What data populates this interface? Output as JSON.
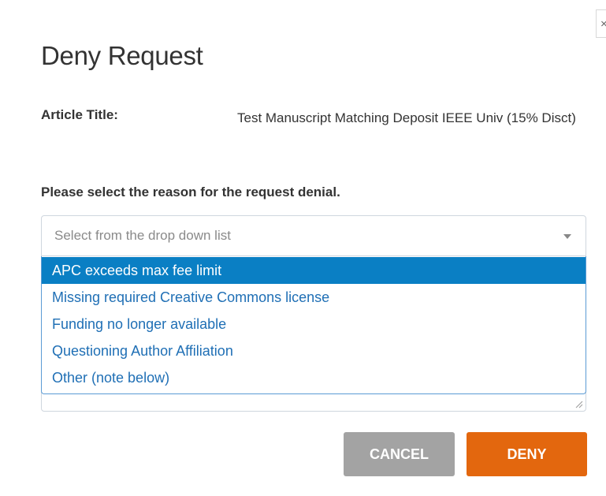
{
  "modal": {
    "title": "Deny Request",
    "close_label": "×",
    "article": {
      "label": "Article Title:",
      "value": "Test Manuscript Matching Deposit IEEE Univ (15% Disct)"
    },
    "reason_heading": "Please select the reason for the request denial.",
    "select": {
      "placeholder": "Select from the drop down list",
      "options": [
        "APC exceeds max fee limit",
        "Missing required Creative Commons license",
        "Funding no longer available",
        "Questioning Author Affiliation",
        "Other (note below)"
      ],
      "highlighted_index": 0
    },
    "buttons": {
      "cancel": "CANCEL",
      "deny": "DENY"
    }
  },
  "colors": {
    "highlight": "#0a7fc4",
    "option_text": "#1f6fb5",
    "deny_button": "#e3670e",
    "cancel_button": "#a3a3a3"
  }
}
